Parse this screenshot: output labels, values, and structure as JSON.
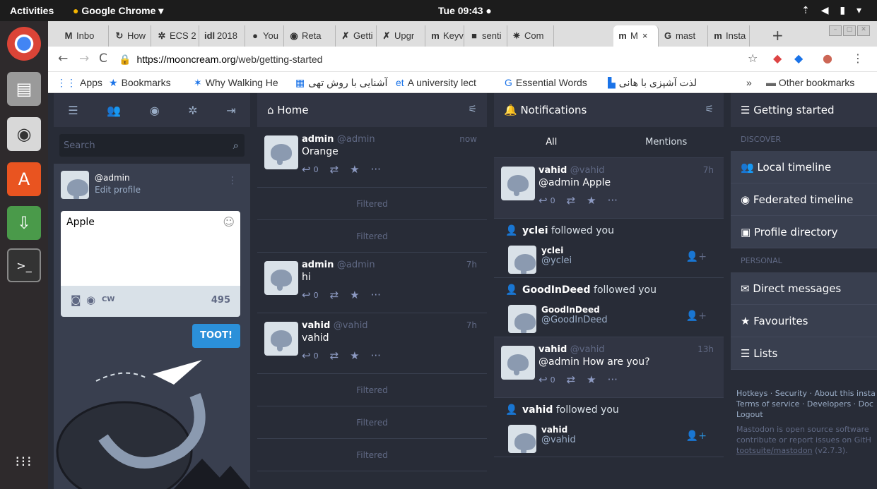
{
  "os": {
    "activities": "Activities",
    "app_name": "Google Chrome ▾",
    "clock": "Tue 09:43 ●",
    "system_tray": "⇡ ◀ ▮ ▾"
  },
  "browser": {
    "tabs": [
      {
        "icon": "M",
        "label": "Inbo"
      },
      {
        "icon": "↻",
        "label": "How"
      },
      {
        "icon": "✲",
        "label": "ECS 2"
      },
      {
        "icon": "idl",
        "label": "2018"
      },
      {
        "icon": "●",
        "label": "You"
      },
      {
        "icon": "◉",
        "label": "Reta"
      },
      {
        "icon": "✗",
        "label": "Getti"
      },
      {
        "icon": "✗",
        "label": "Upgr"
      },
      {
        "icon": "m",
        "label": "Keyv"
      },
      {
        "icon": "■",
        "label": "senti"
      },
      {
        "icon": "✷",
        "label": "Com"
      },
      {
        "icon": "m",
        "label": "M"
      },
      {
        "icon": "G",
        "label": "mast"
      },
      {
        "icon": "m",
        "label": "Insta"
      }
    ],
    "active_tab_close": "×",
    "url_host": "https://mooncream.org",
    "url_path": "/web/getting-started",
    "bookmarks": [
      {
        "icon": "⋮⋮",
        "label": "Apps"
      },
      {
        "icon": "★",
        "label": "Bookmarks"
      },
      {
        "icon": "✶",
        "label": "Why Walking He"
      },
      {
        "icon": "▦",
        "label": "آشنایی با روش تهی"
      },
      {
        "icon": "et",
        "label": "A university lect"
      },
      {
        "icon": "G",
        "label": "Essential Words"
      },
      {
        "icon": "▙",
        "label": "لذت آشپزی با هانی"
      }
    ],
    "bookmarks_more": "»",
    "other_bookmarks": "Other bookmarks"
  },
  "compose": {
    "search_placeholder": "Search",
    "acct": "@admin",
    "edit_profile": "Edit profile",
    "text": "Apple",
    "cw": "CW",
    "char_count": "495",
    "toot": "TOOT!"
  },
  "home": {
    "title": "Home",
    "items": [
      {
        "kind": "status",
        "name": "admin",
        "acct": "@admin",
        "time": "now",
        "text": "Orange"
      },
      {
        "kind": "filtered",
        "label": "Filtered"
      },
      {
        "kind": "filtered",
        "label": "Filtered"
      },
      {
        "kind": "status",
        "name": "admin",
        "acct": "@admin",
        "time": "7h",
        "text": "hi"
      },
      {
        "kind": "status",
        "name": "vahid",
        "acct": "@vahid",
        "time": "7h",
        "text": "vahid"
      },
      {
        "kind": "filtered",
        "label": "Filtered"
      },
      {
        "kind": "filtered",
        "label": "Filtered"
      },
      {
        "kind": "filtered",
        "label": "Filtered"
      }
    ],
    "reply_count": "0"
  },
  "notifications": {
    "title": "Notifications",
    "tab_all": "All",
    "tab_mentions": "Mentions",
    "items": [
      {
        "kind": "status",
        "name": "vahid",
        "acct": "@vahid",
        "time": "7h",
        "text": "@admin Apple"
      },
      {
        "kind": "follow",
        "who": "yclei",
        "suffix": "followed you",
        "name": "yclei",
        "acct": "@yclei"
      },
      {
        "kind": "follow",
        "who": "GoodInDeed",
        "suffix": "followed you",
        "name": "GoodInDeed",
        "acct": "@GoodInDeed"
      },
      {
        "kind": "status",
        "name": "vahid",
        "acct": "@vahid",
        "time": "13h",
        "text": "@admin How are you?"
      },
      {
        "kind": "follow",
        "who": "vahid",
        "suffix": "followed you",
        "name": "vahid",
        "acct": "@vahid"
      }
    ]
  },
  "getting_started": {
    "title": "Getting started",
    "discover": "DISCOVER",
    "local": "Local timeline",
    "federated": "Federated timeline",
    "directory": "Profile directory",
    "personal": "PERSONAL",
    "dms": "Direct messages",
    "favourites": "Favourites",
    "lists": "Lists",
    "footer1": "Hotkeys · Security · About this insta",
    "footer2": "Terms of service · Developers · Doc",
    "footer3": "Logout",
    "footer4": "Mastodon is open source software",
    "footer5": "contribute or report issues on GitH",
    "footer6_link": "tootsuite/mastodon",
    "footer6_ver": " (v2.7.3)."
  },
  "colors": {
    "bg": "#191b22",
    "column": "#282c37",
    "header": "#313543",
    "accent": "#2b90d9",
    "muted": "#606984"
  }
}
